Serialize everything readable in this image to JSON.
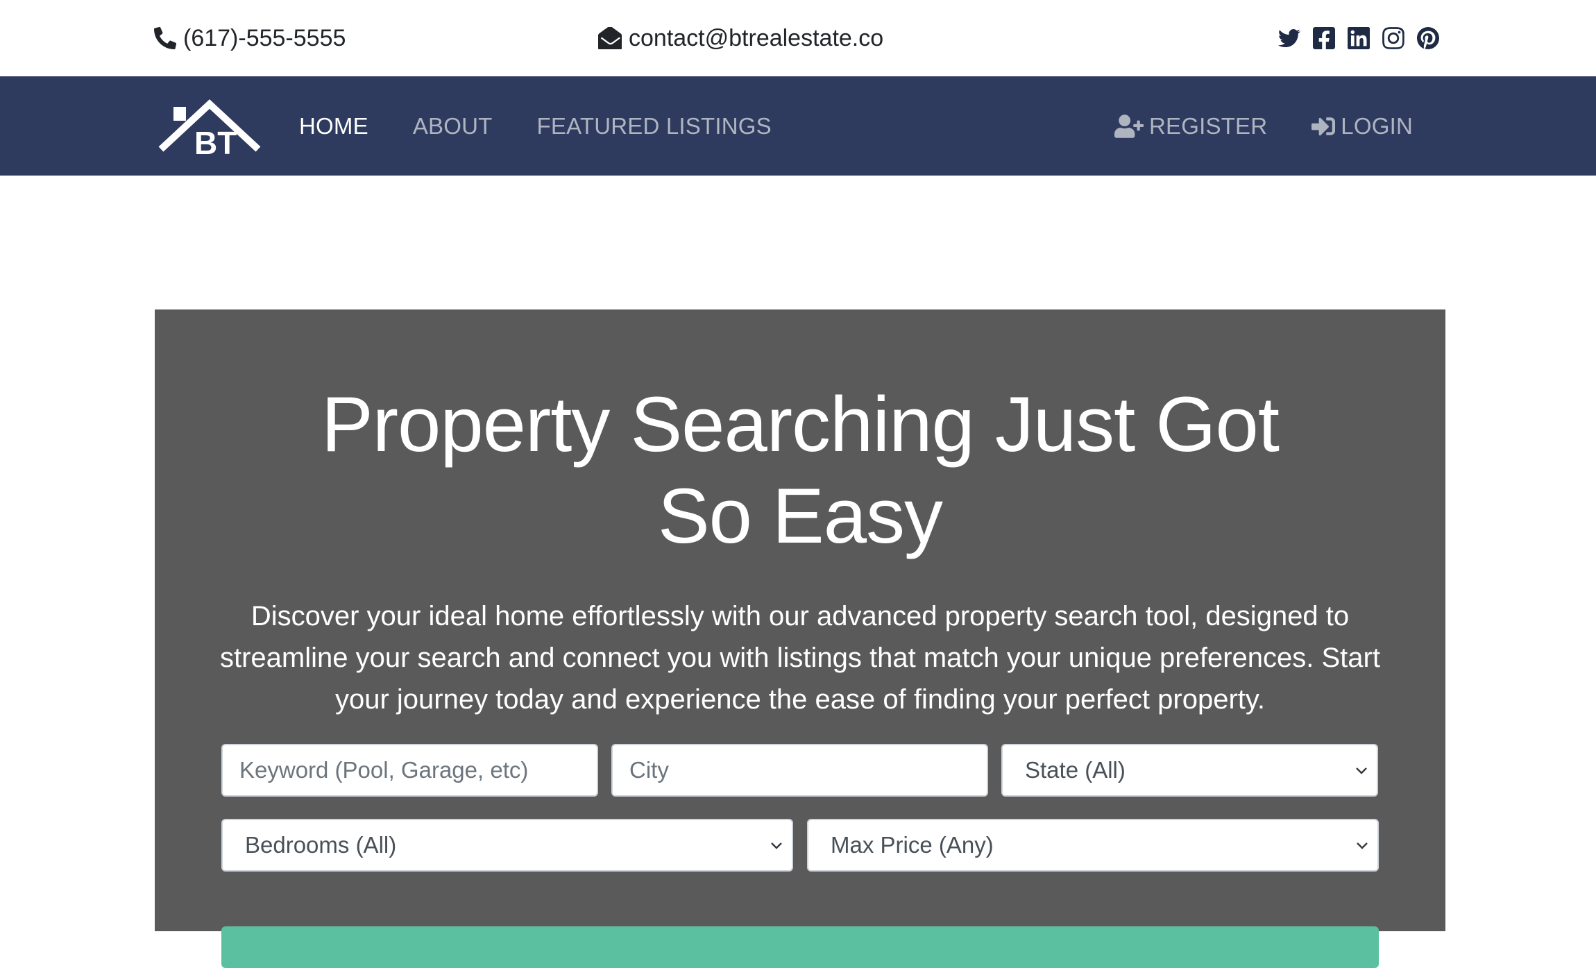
{
  "topbar": {
    "phone": "(617)-555-5555",
    "email": "contact@btrealestate.co",
    "social_icons": [
      "twitter-icon",
      "facebook-icon",
      "linkedin-icon",
      "instagram-icon",
      "pinterest-icon"
    ]
  },
  "navbar": {
    "brand_text": "BT",
    "links": [
      {
        "label": "HOME",
        "active": true
      },
      {
        "label": "ABOUT",
        "active": false
      },
      {
        "label": "FEATURED LISTINGS",
        "active": false
      }
    ],
    "right_links": [
      {
        "label": "REGISTER",
        "icon": "user-plus-icon"
      },
      {
        "label": "LOGIN",
        "icon": "sign-in-icon"
      }
    ],
    "background": "#2e3b5e"
  },
  "showcase": {
    "title": "Property Searching Just Got So Easy",
    "lead": "Discover your ideal home effortlessly with our advanced property search tool, designed to streamline your search and connect you with listings that match your unique preferences. Start your journey today and experience the ease of finding your perfect property.",
    "background": "#5a5a5a"
  },
  "search": {
    "keyword_placeholder": "Keyword (Pool, Garage, etc)",
    "city_placeholder": "City",
    "state_selected": "State (All)",
    "bedrooms_selected": "Bedrooms (All)",
    "max_price_selected": "Max Price (Any)",
    "submit_color": "#5bc0a0"
  }
}
